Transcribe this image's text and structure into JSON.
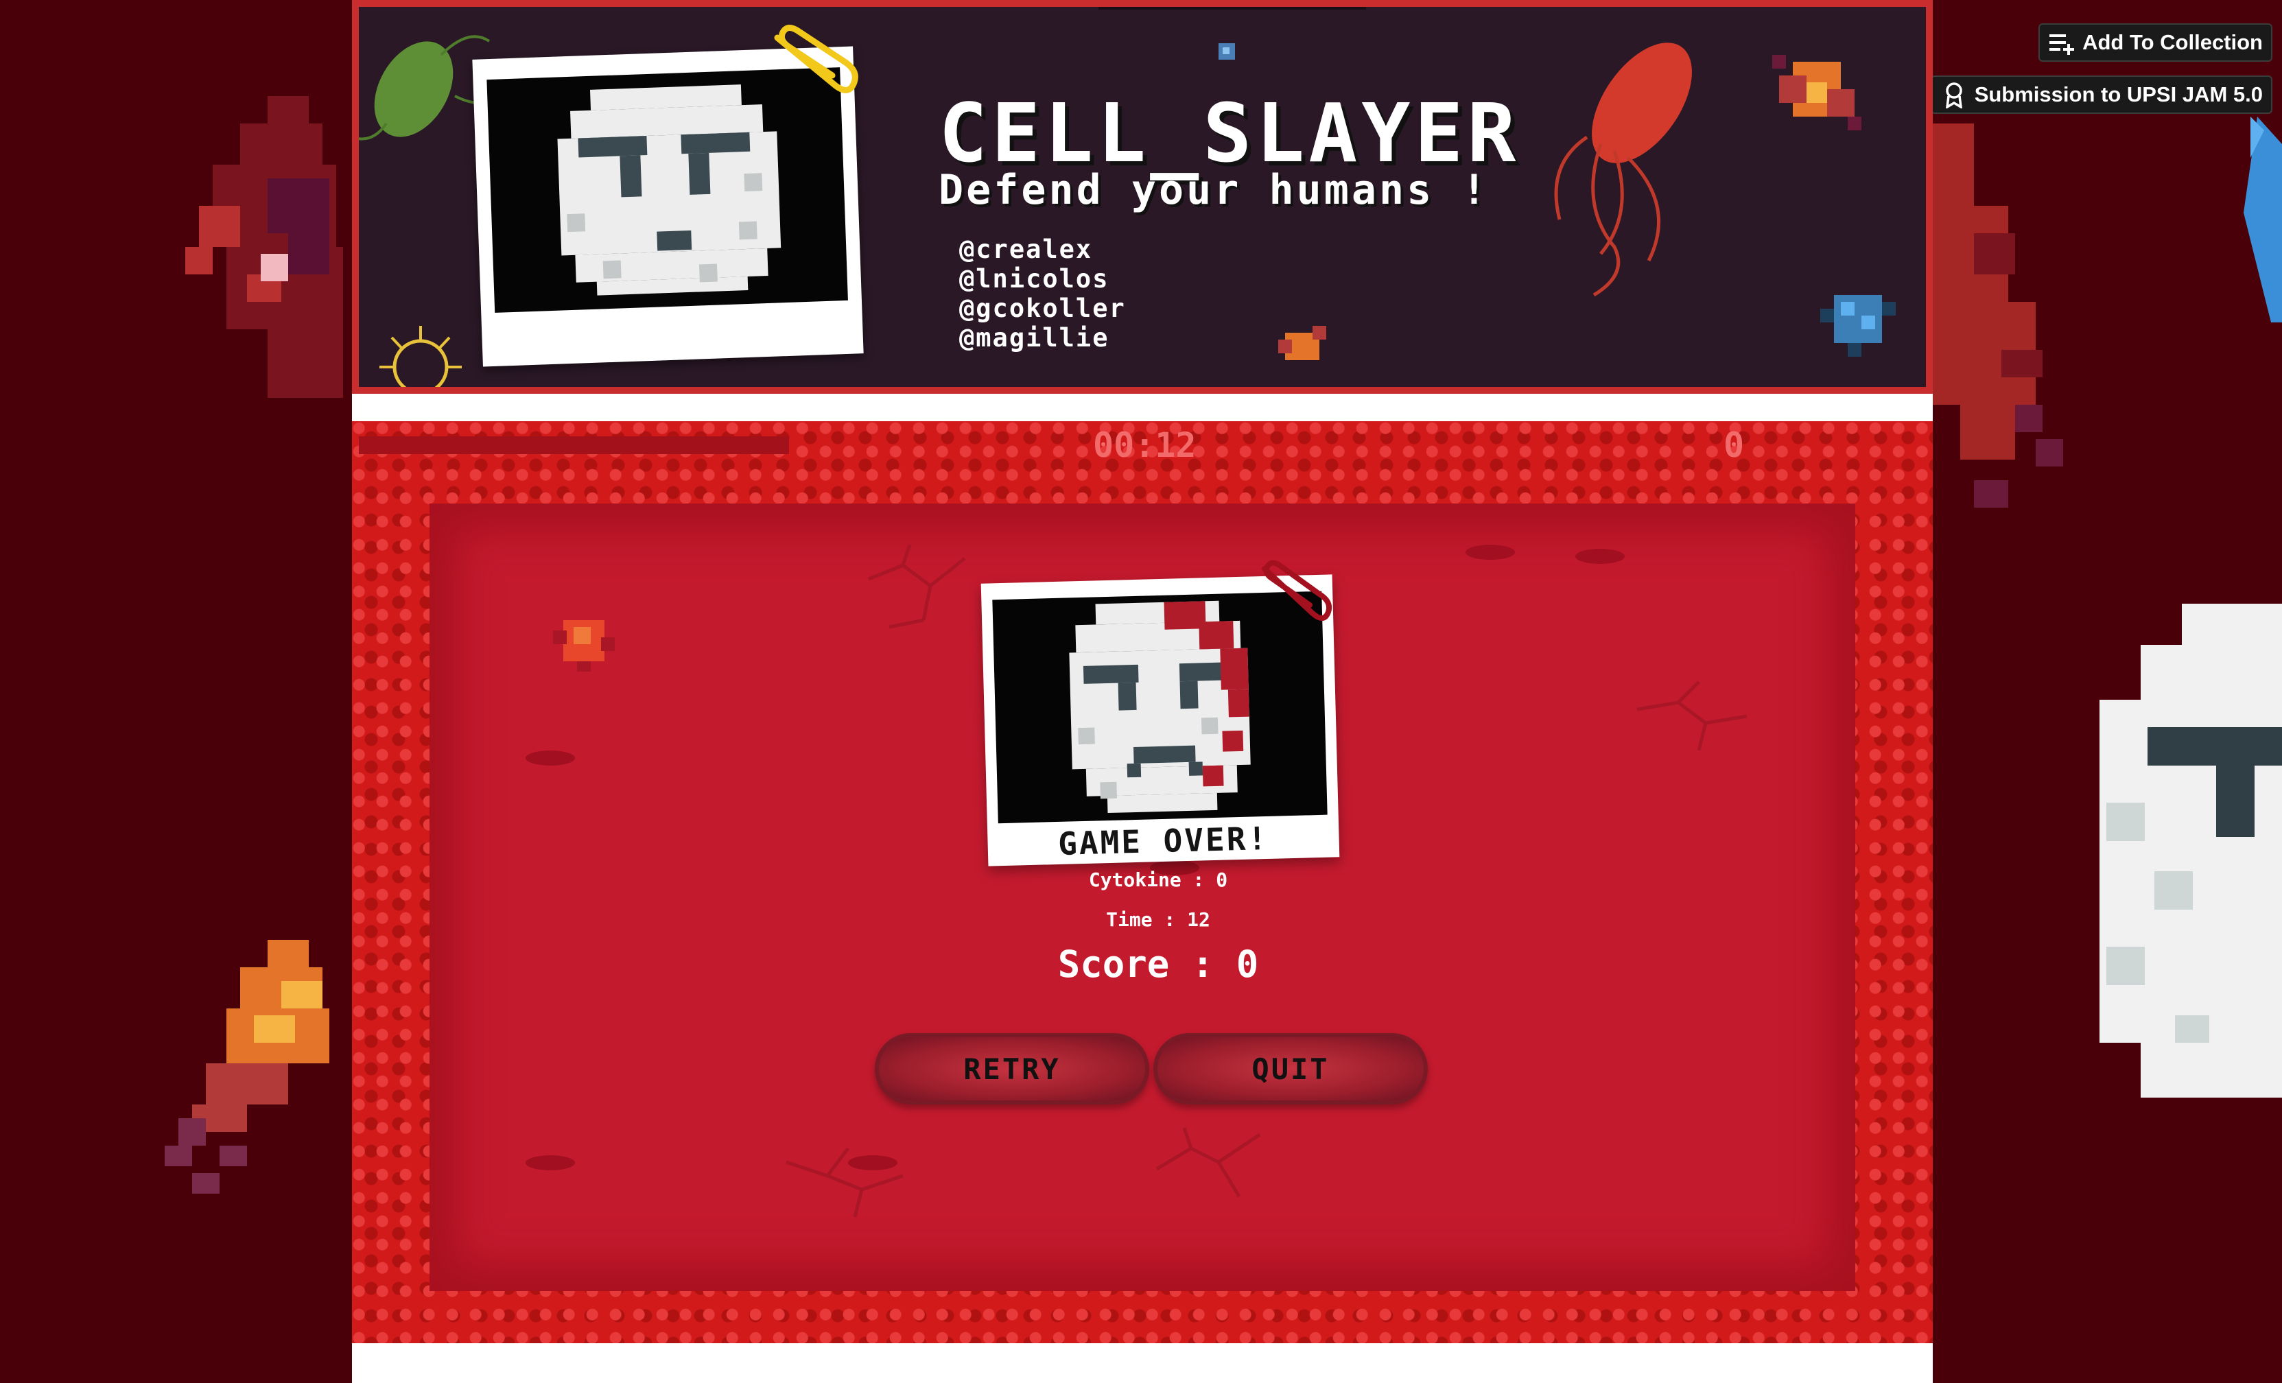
{
  "page": {
    "add_to_collection": "Add To Collection",
    "submission": "Submission to UPSI JAM 5.0"
  },
  "banner": {
    "title": "CELL_SLAYER",
    "subtitle": "Defend your humans !",
    "handles": [
      "@crealex",
      "@lnicolos",
      "@gcokoller",
      "@magillie"
    ]
  },
  "hud": {
    "timer": "00:12",
    "count": "0"
  },
  "game_over": {
    "title": "GAME OVER!",
    "cytokine": "Cytokine : 0",
    "time": "Time : 12",
    "score": "Score : 0",
    "retry": "RETRY",
    "quit": "QUIT"
  },
  "colors": {
    "page_bg": "#4a0008",
    "banner_bg": "#2a1826",
    "banner_border": "#c92d2d",
    "game_bg": "#c41a2e",
    "hud_text": "#f26a6a"
  },
  "icons": [
    "add-to-list-icon",
    "award-ribbon-icon",
    "paperclip-icon"
  ]
}
